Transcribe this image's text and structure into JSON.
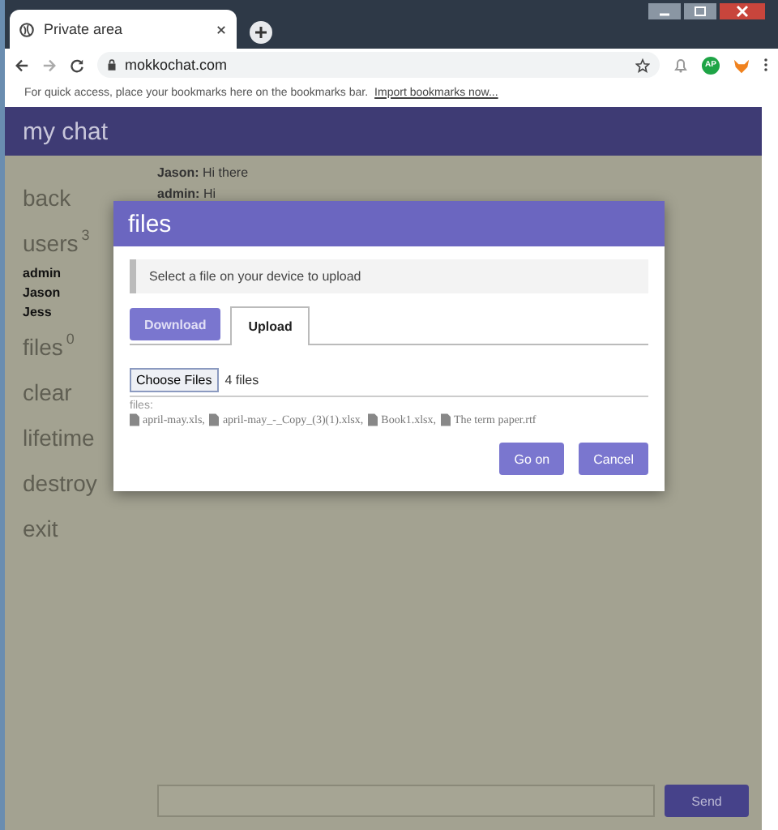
{
  "browser": {
    "tab_title": "Private area",
    "url": "mokkochat.com",
    "profile_initials": "AP",
    "bookmarks_hint": "For quick access, place your bookmarks here on the bookmarks bar.",
    "import_link": "Import bookmarks now..."
  },
  "app": {
    "title": "my chat",
    "sidebar": [
      {
        "kind": "link",
        "label": "back"
      },
      {
        "kind": "link",
        "label": "users",
        "count": "3"
      },
      {
        "kind": "user",
        "label": "admin"
      },
      {
        "kind": "user",
        "label": "Jason"
      },
      {
        "kind": "user",
        "label": "Jess"
      },
      {
        "kind": "link",
        "label": "files",
        "count": "0"
      },
      {
        "kind": "link",
        "label": "clear"
      },
      {
        "kind": "link",
        "label": "lifetime"
      },
      {
        "kind": "link",
        "label": "destroy"
      },
      {
        "kind": "link",
        "label": "exit"
      }
    ],
    "messages": [
      {
        "sender": "Jason:",
        "text": "Hi there"
      },
      {
        "sender": "admin:",
        "text": "Hi"
      }
    ],
    "send_button": "Send"
  },
  "modal": {
    "title": "files",
    "info": "Select a file on your device to upload",
    "tabs": [
      {
        "label": "Download",
        "selected": false
      },
      {
        "label": "Upload",
        "selected": true
      }
    ],
    "choose_button": "Choose Files",
    "file_count": "4 files",
    "files_label": "files:",
    "files": [
      "april-may.xls,",
      "april-may_-_Copy_(3)(1).xlsx,",
      "Book1.xlsx,",
      "The term paper.rtf"
    ],
    "buttons": [
      "Go on",
      "Cancel"
    ]
  }
}
